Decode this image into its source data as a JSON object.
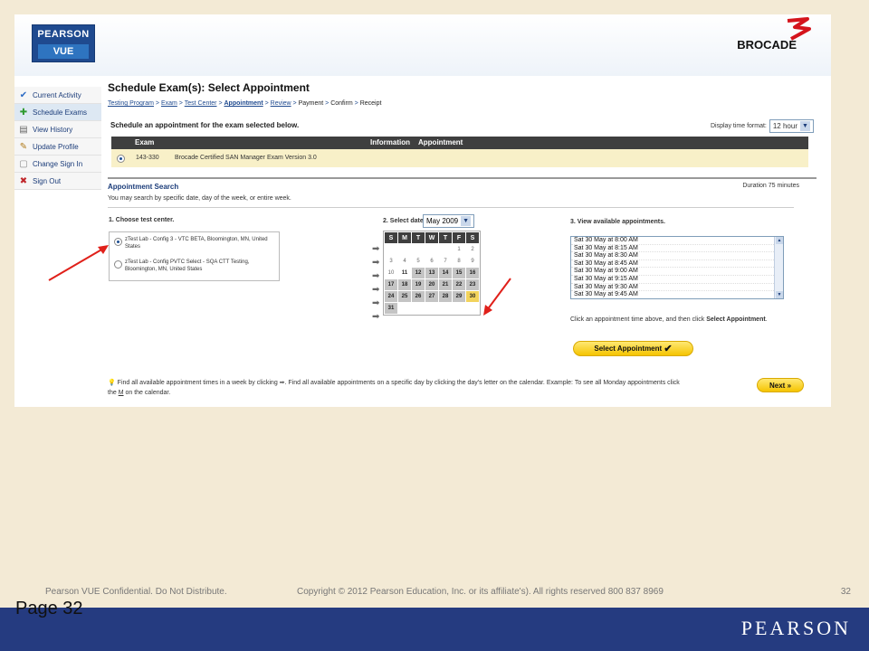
{
  "header": {
    "pearson_vue_top": "PEARSON",
    "pearson_vue_bottom": "VUE",
    "brocade": "BROCADE"
  },
  "sidebar": {
    "items": [
      {
        "label": "Current Activity",
        "icon": "check-icon"
      },
      {
        "label": "Schedule Exams",
        "icon": "add-icon"
      },
      {
        "label": "View History",
        "icon": "history-icon"
      },
      {
        "label": "Update Profile",
        "icon": "edit-icon"
      },
      {
        "label": "Change Sign In",
        "icon": "lock-icon"
      },
      {
        "label": "Sign Out",
        "icon": "close-icon"
      }
    ]
  },
  "main": {
    "title": "Schedule Exam(s): Select Appointment",
    "breadcrumb": [
      "Testing Program",
      "Exam",
      "Test Center",
      "Appointment",
      "Review",
      "Payment",
      "Confirm",
      "Receipt"
    ],
    "schedule_line": "Schedule an appointment for the exam selected below.",
    "tz_label": "Display time format:",
    "tz_value": "12 hour",
    "exam_headers": {
      "exam": "Exam",
      "info": "Information",
      "appt": "Appointment"
    },
    "exam_row": {
      "code": "143-330",
      "name": "Brocade Certified SAN Manager Exam Version 3.0"
    },
    "search_title": "Appointment Search",
    "search_sub": "You may search by specific date, day of the week, or entire week.",
    "duration": "Duration 75 minutes",
    "step1": "1. Choose test center.",
    "center1": "zTest Lab - Config 3 - VTC BETA, Bloomington, MN, United States",
    "center2": "zTest Lab - Config PVTC Select - SQA CTT Testing, Bloomington, MN, United States",
    "step2": "2. Select date.",
    "month": "May 2009",
    "weekdays": [
      "S",
      "M",
      "T",
      "W",
      "T",
      "F",
      "S"
    ],
    "step3": "3. View available appointments.",
    "appointments": [
      "Sat 30 May at 8:00 AM",
      "Sat 30 May at 8:15 AM",
      "Sat 30 May at 8:30 AM",
      "Sat 30 May at 8:45 AM",
      "Sat 30 May at 9:00 AM",
      "Sat 30 May at 9:15 AM",
      "Sat 30 May at 9:30 AM",
      "Sat 30 May at 9:45 AM"
    ],
    "appt_help_1": "Click an appointment time above, and then click ",
    "appt_help_bold": "Select Appointment",
    "appt_help_2": ".",
    "select_btn": "Select Appointment",
    "tip_1": "Find all available appointment times in a week by clicking",
    "tip_2": ". Find all available appointments on a specific day by clicking the day's letter on the calendar. Example: To see all Monday appointments click the ",
    "tip_m": "M",
    "tip_3": " on the calendar.",
    "next_btn": "Next"
  },
  "footer": {
    "confidential": "Pearson VUE Confidential. Do Not Distribute.",
    "copyright": "Copyright © 2012 Pearson Education, Inc. or its affiliate's). All rights reserved 800 837 8969",
    "page_num": "32",
    "page_label": "Page 32",
    "brand": "PEARSON"
  },
  "colors": {
    "band": "#253b80",
    "accent_yellow": "#f5c400",
    "bg": "#f3ead5"
  }
}
